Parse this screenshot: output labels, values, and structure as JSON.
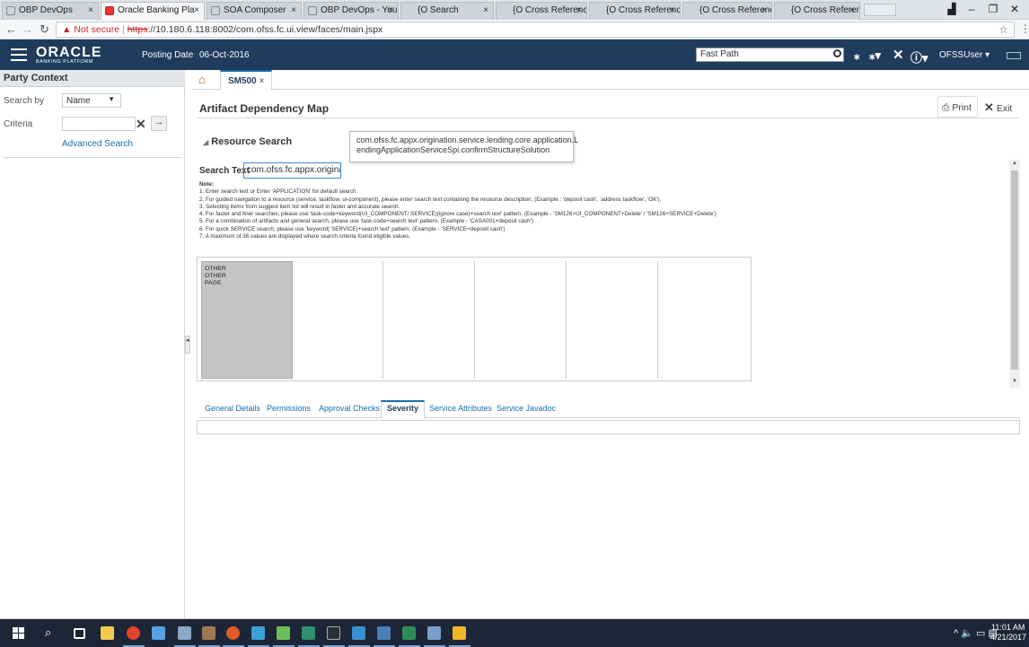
{
  "browser": {
    "tabs": [
      {
        "label": "OBP DevOps",
        "active": false
      },
      {
        "label": "Oracle Banking Pla",
        "active": true
      },
      {
        "label": "SOA Composer",
        "active": false
      },
      {
        "label": "OBP DevOps - You",
        "active": false
      },
      {
        "label": "{O Search",
        "active": false
      },
      {
        "label": "{O Cross Reference: /",
        "active": false
      },
      {
        "label": "{O Cross Reference: /",
        "active": false
      },
      {
        "label": "{O Cross Reference: /",
        "active": false
      },
      {
        "label": "{O Cross Reference: /",
        "active": false
      }
    ],
    "security_warning": "Not secure",
    "url_scheme": "https",
    "url_rest": "://10.180.6.118:8002/com.ofss.fc.ui.view/faces/main.jspx"
  },
  "header": {
    "logo_main": "ORACLE",
    "logo_sub": "BANKING PLATFORM",
    "posting_date_label": "Posting Date",
    "posting_date_value": "06-Oct-2016",
    "fast_path_value": "Fast Path",
    "user_name": "OFSSUser"
  },
  "left_panel": {
    "title": "Party Context",
    "search_by_label": "Search by",
    "search_by_value": "Name",
    "criteria_label": "Criteria",
    "advanced_search": "Advanced Search"
  },
  "content_tabs": {
    "active_tab": "SM500"
  },
  "page": {
    "title": "Artifact Dependency Map",
    "print_label": "Print",
    "exit_label": "Exit"
  },
  "resource_search": {
    "title": "Resource Search",
    "tooltip_line1": "com.ofss.fc.appx.origination.service.lending.core.application.L",
    "tooltip_line2": "endingApplicationServiceSpi.confirmStructureSolution",
    "search_text_label": "Search Text",
    "search_text_value": "com.ofss.fc.appx.originatior"
  },
  "notes": {
    "title": "Note:",
    "lines": [
      "1. Enter search text or Enter 'APPLICATION' for default search.",
      "2. For guided navigation to a resource (service, taskflow, ui-component), please enter search text containing the resource description. (Example : 'deposit cash', 'address taskflow', 'OK').",
      "3. Selecting items from suggest item list will result in faster and accurate search.",
      "4. For faster and finer searches, please use 'task-code+keyword(UI_COMPONENT/ SERVICE)(ignore case)+search text' pattern. (Example - 'SM126+UI_COMPONENT+Delete' / 'SM126+SERVICE+Delete')",
      "5. For a combination of artifacts and general search, please use 'task-code+search text' pattern. (Example - 'CASA001+deposit cash')",
      "6. For quick SERVICE search, please use 'keyword( SERVICE)+search text' pattern. (Example - 'SERVICE+deposit cash')",
      "7. A maximum of 36 values are displayed where search criteria found eligible values."
    ]
  },
  "grid": {
    "column0_items": [
      "OTHER",
      "OTHER",
      "PAGE"
    ]
  },
  "detail_tabs": [
    {
      "label": "General Details",
      "active": false
    },
    {
      "label": "Permissions",
      "active": false
    },
    {
      "label": "Approval Checks",
      "active": false
    },
    {
      "label": "Severity",
      "active": true
    },
    {
      "label": "Service Attributes",
      "active": false
    },
    {
      "label": "Service Javadoc",
      "active": false
    }
  ],
  "taskbar": {
    "time": "11:01 AM",
    "date": "4/21/2017"
  },
  "colors": {
    "header_bg": "#1f3c5c",
    "link": "#1a6ea8",
    "taskbar_bg": "#1c2636"
  }
}
